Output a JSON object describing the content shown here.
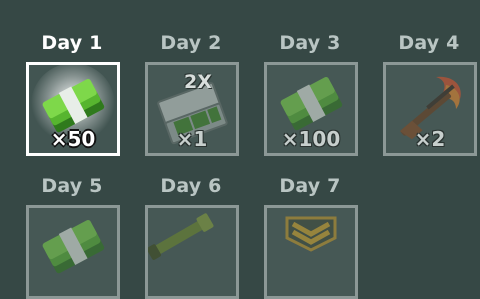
{
  "rewards": [
    {
      "day": "Day 1",
      "qty": "×50",
      "icon": "cash-stack-icon",
      "state": "current"
    },
    {
      "day": "Day 2",
      "qty": "×1",
      "badge": "2X",
      "icon": "cash-case-icon",
      "state": "locked"
    },
    {
      "day": "Day 3",
      "qty": "×100",
      "icon": "cash-stack-icon",
      "state": "locked"
    },
    {
      "day": "Day 4",
      "qty": "×2",
      "icon": "flaming-rifle-icon",
      "state": "locked"
    },
    {
      "day": "Day 5",
      "icon": "cash-stack-icon",
      "state": "locked"
    },
    {
      "day": "Day 6",
      "icon": "rocket-launcher-icon",
      "state": "locked"
    },
    {
      "day": "Day 7",
      "icon": "rank-chevron-icon",
      "state": "locked"
    }
  ]
}
